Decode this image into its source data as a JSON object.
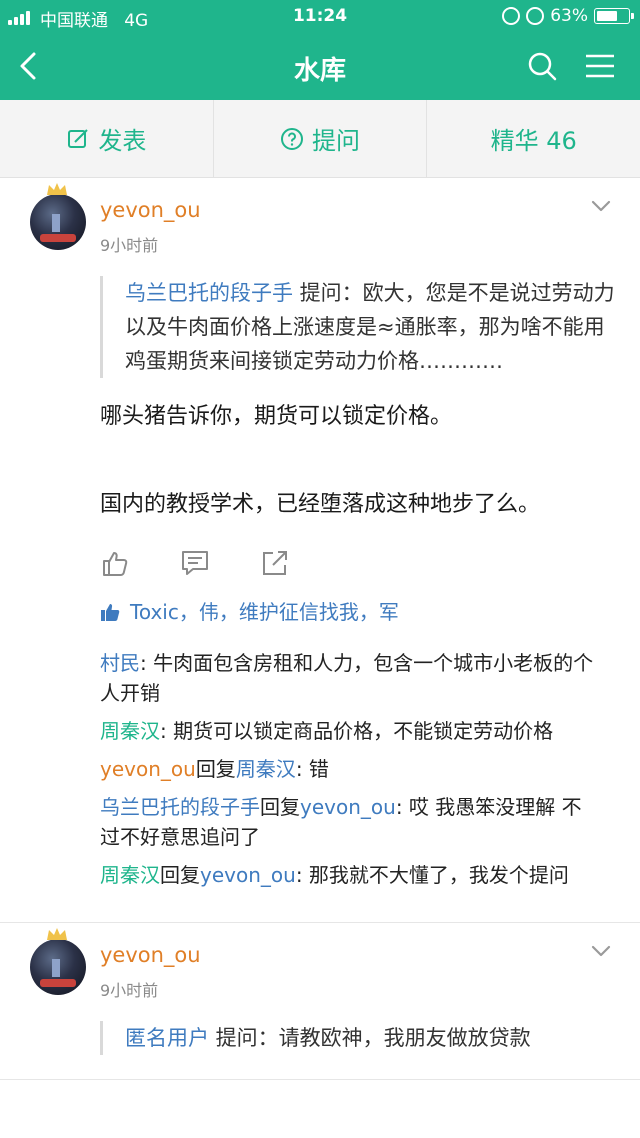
{
  "status_bar": {
    "carrier": "中国联通",
    "network": "4G",
    "time": "11:24",
    "battery": "63%"
  },
  "header": {
    "title": "水库",
    "back_icon": "chevron-left-icon",
    "search_icon": "search-icon",
    "menu_icon": "hamburger-icon"
  },
  "actions": {
    "post_label": "发表",
    "ask_label": "提问",
    "featured_label": "精华 46"
  },
  "posts": [
    {
      "author": "yevon_ou",
      "time": "9小时前",
      "quote_name": "乌兰巴托的段子手",
      "quote_text": " 提问：欧大，您是不是说过劳动力以及牛肉面价格上涨速度是≈通胀率，那为啥不能用鸡蛋期货来间接锁定劳动力价格…………",
      "para1": "哪头猪告诉你，期货可以锁定价格。",
      "para2": "国内的教授学术，已经堕落成这种地步了么。",
      "likes": "Toxic，伟，维护征信找我，军",
      "comments": [
        {
          "author": "村民",
          "reply_to": "",
          "text": ": 牛肉面包含房租和人力，包含一个城市小老板的个人开销"
        },
        {
          "author": "周秦汉",
          "reply_to": "",
          "text": ": 期货可以锁定商品价格，不能锁定劳动价格"
        },
        {
          "author": "yevon_ou",
          "reply_word": "回复",
          "reply_to": "周秦汉",
          "text": ": 错"
        },
        {
          "author": "乌兰巴托的段子手",
          "reply_word": "回复",
          "reply_to": "yevon_ou",
          "text": ": 哎 我愚笨没理解 不过不好意思追问了"
        },
        {
          "author": "周秦汉",
          "reply_word": "回复",
          "reply_to": "yevon_ou",
          "text": ": 那我就不大懂了，我发个提问"
        }
      ]
    },
    {
      "author": "yevon_ou",
      "time": "9小时前",
      "quote_name": "匿名用户",
      "quote_text": " 提问：请教欧神，我朋友做放贷款"
    }
  ],
  "colors": {
    "brand": "#1fb58c",
    "link": "#3f7bbf",
    "author": "#e07f27"
  }
}
